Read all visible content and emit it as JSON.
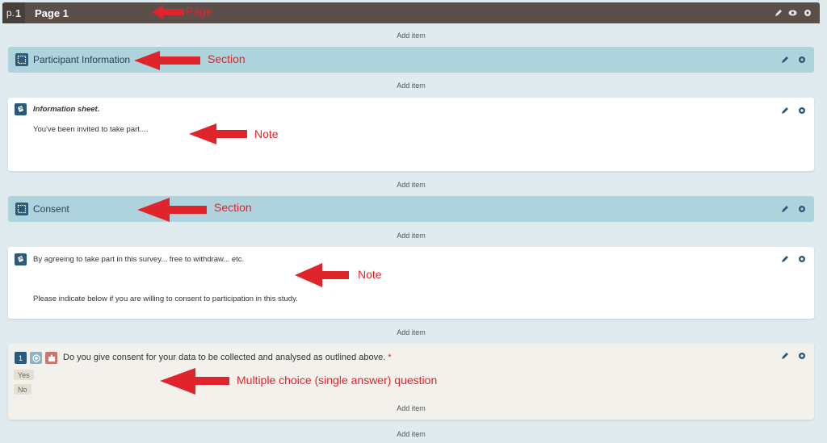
{
  "page": {
    "number_prefix": "p.",
    "number": "1",
    "title": "Page 1"
  },
  "add_item_label": "Add item",
  "sections": [
    {
      "title": "Participant Information"
    },
    {
      "title": "Consent"
    }
  ],
  "notes": [
    {
      "title": "Information sheet.",
      "body": "You've been invited to take part...."
    },
    {
      "line1": "By agreeing to take part in this survey... free to withdraw... etc.",
      "line2": "Please indicate below if you are willing to consent to participation in this study."
    }
  ],
  "question": {
    "number": "1",
    "text": "Do you give consent for your data to be collected and analysed as outlined above.",
    "required_mark": "*",
    "options": [
      "Yes",
      "No"
    ]
  },
  "annotations": {
    "page": "Page",
    "section1": "Section",
    "note1": "Note",
    "section2": "Section",
    "note2": "Note",
    "question": "Multiple choice (single answer) question"
  },
  "icons": {
    "section": "section-icon",
    "note": "note-icon",
    "edit": "pencil-icon",
    "settings": "gear-icon",
    "preview": "eye-icon",
    "question_type": "radio-icon",
    "question_logic": "puzzle-icon"
  },
  "colors": {
    "page_bar": "#5a5049",
    "section_bg": "#aed3dc",
    "question_bg": "#f3f1ec",
    "icon_blue": "#2b5a78",
    "annotation_red": "#e0242b",
    "required_red": "#d9232a"
  }
}
